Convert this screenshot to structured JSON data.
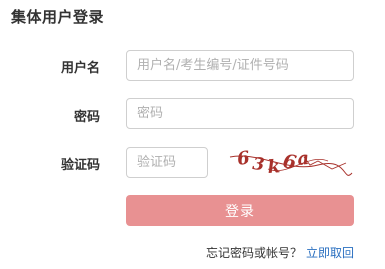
{
  "title": "集体用户登录",
  "form": {
    "username_label": "用户名",
    "username_placeholder": "用户名/考生编号/证件号码",
    "password_label": "密码",
    "password_placeholder": "密码",
    "captcha_label": "验证码",
    "captcha_placeholder": "验证码",
    "captcha_text": "63k6a"
  },
  "login_button": "登录",
  "forgot": {
    "question": "忘记密码或帐号？",
    "link": "立即取回"
  },
  "colors": {
    "button": "#e89192",
    "link": "#2a6fc0",
    "captcha_ink": "#a8312b"
  }
}
